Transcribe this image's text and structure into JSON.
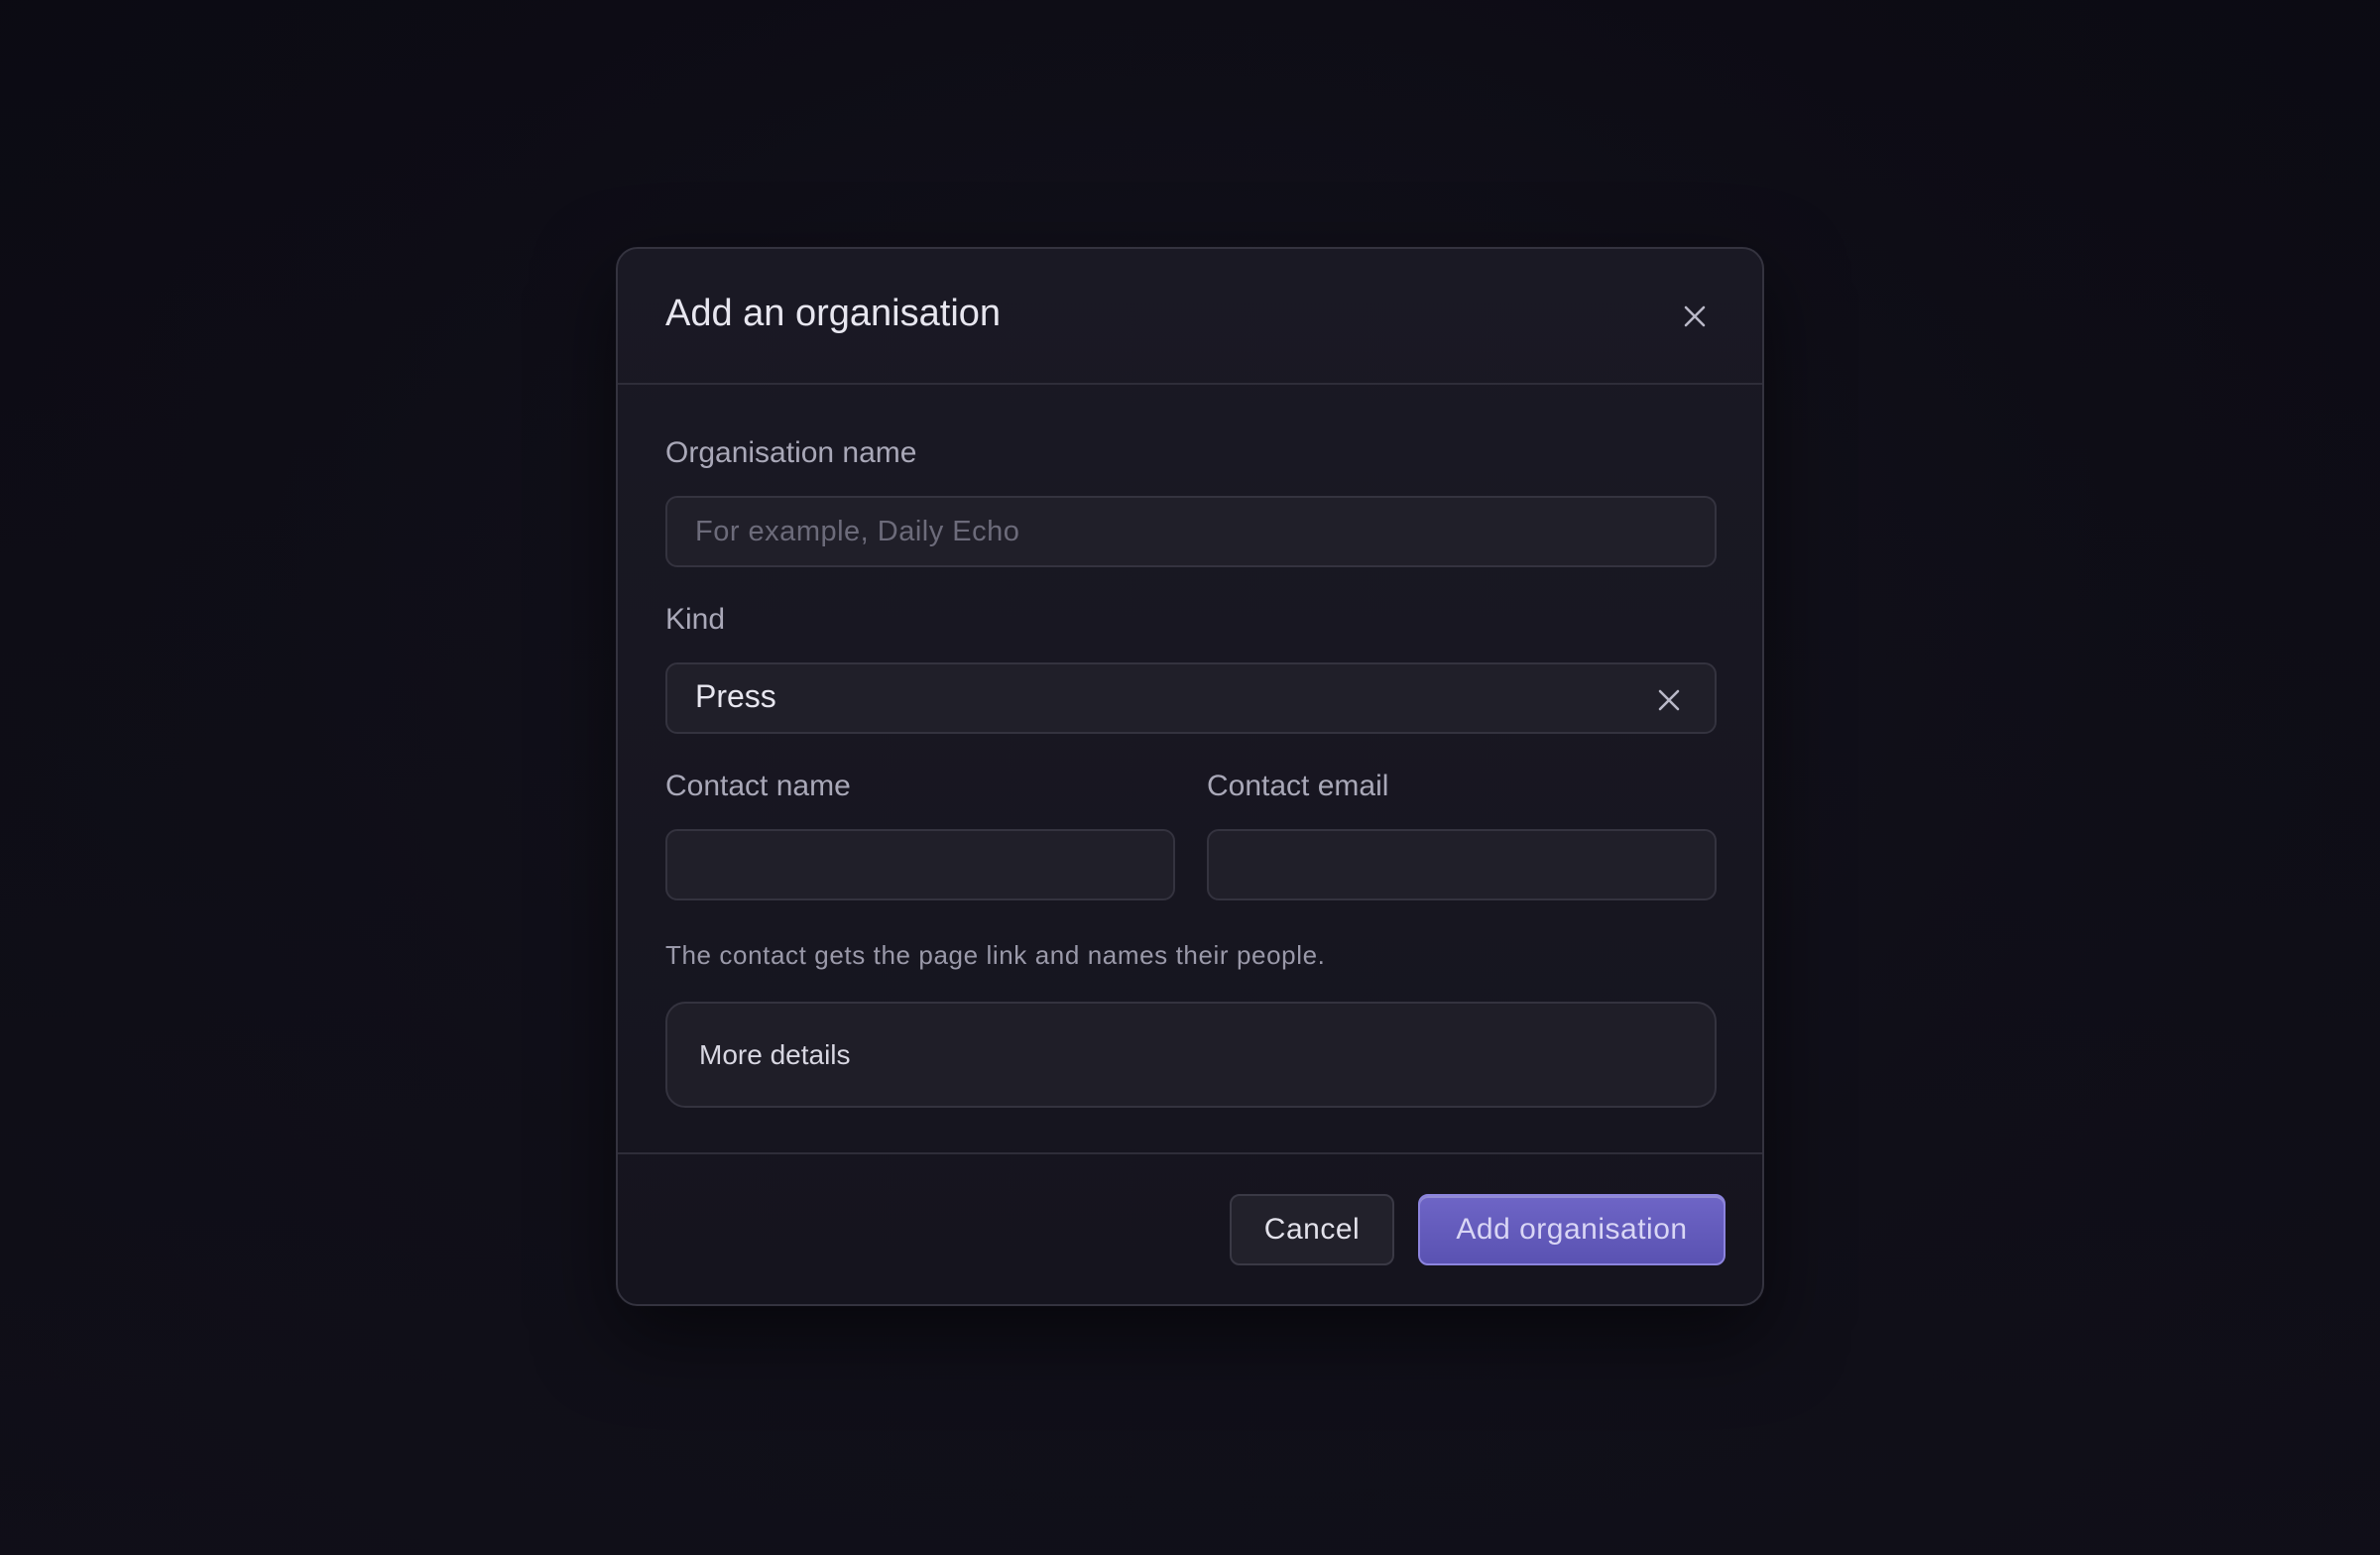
{
  "dialog": {
    "title": "Add an organisation",
    "close_icon": "close-icon"
  },
  "form": {
    "organisation_name": {
      "label": "Organisation name",
      "value": "",
      "placeholder": "For example, Daily Echo"
    },
    "kind": {
      "label": "Kind",
      "selected": "Press",
      "clear_icon": "close-icon"
    },
    "contact_name": {
      "label": "Contact name",
      "value": ""
    },
    "contact_email": {
      "label": "Contact email",
      "value": ""
    },
    "hint": "The contact gets the page link and names their people.",
    "more_details_label": "More details"
  },
  "footer": {
    "cancel_label": "Cancel",
    "submit_label": "Add organisation"
  },
  "colors": {
    "accent": "#6b63c4",
    "background": "#0d0c15",
    "dialog_surface": "#1a1924"
  }
}
